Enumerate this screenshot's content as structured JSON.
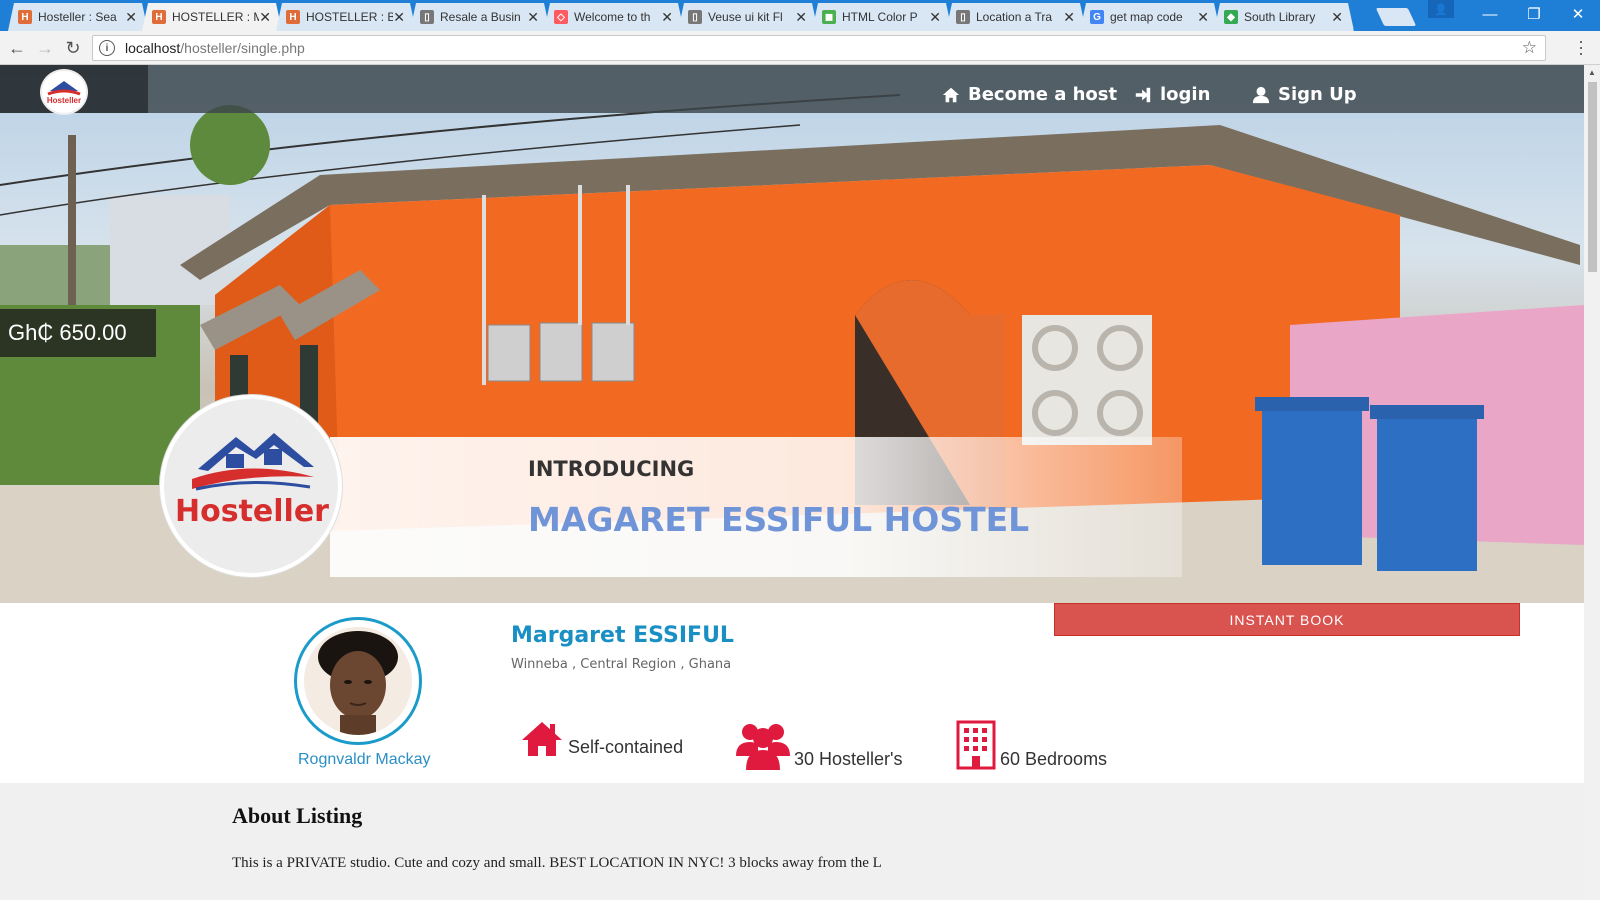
{
  "browser": {
    "tabs": [
      {
        "title": "Hosteller : Sea",
        "fav_color": "#e06c3a",
        "fav": "H"
      },
      {
        "title": "HOSTELLER : M",
        "fav_color": "#e06c3a",
        "fav": "H",
        "active": true
      },
      {
        "title": "HOSTELLER : B",
        "fav_color": "#e06c3a",
        "fav": "H"
      },
      {
        "title": "Resale a Busin",
        "fav_color": "#777777",
        "fav": "▯"
      },
      {
        "title": "Welcome to th",
        "fav_color": "#ff5a5f",
        "fav": "◇"
      },
      {
        "title": "Veuse ui kit Fl",
        "fav_color": "#777777",
        "fav": "▯"
      },
      {
        "title": "HTML Color P",
        "fav_color": "#4caf50",
        "fav": "◼"
      },
      {
        "title": "Location a Tra",
        "fav_color": "#777777",
        "fav": "▯"
      },
      {
        "title": "get map code",
        "fav_color": "#4285f4",
        "fav": "G"
      },
      {
        "title": "South Library",
        "fav_color": "#34a853",
        "fav": "◆"
      }
    ],
    "url_host": "localhost",
    "url_path": "/hosteller/single.php"
  },
  "nav": {
    "become_host": "Become a host",
    "login": "login",
    "signup": "Sign Up"
  },
  "hero": {
    "price": "Gh₵ 650.00",
    "intro_label": "INTRODUCING",
    "hostel_name": "MAGARET ESSIFUL HOSTEL",
    "logo_text": "Hosteller",
    "logo_small_text": "Hosteller"
  },
  "listing": {
    "instant_book": "INSTANT BOOK",
    "owner": "Margaret ESSIFUL",
    "location": "Winneba , Central Region , Ghana",
    "host_name": "Rognvaldr Mackay",
    "features": [
      {
        "icon": "house-icon",
        "label": "Self-contained"
      },
      {
        "icon": "users-icon",
        "label": "30 Hosteller's"
      },
      {
        "icon": "building-icon",
        "label": "60 Bedrooms"
      }
    ]
  },
  "about": {
    "title": "About Listing",
    "text": "This is a PRIVATE studio. Cute and cozy and small. BEST LOCATION IN NYC! 3 blocks away from the L"
  },
  "colors": {
    "accent_red": "#d9534f",
    "brand_blue": "#1a8fc4",
    "title_blue": "#6f95d8",
    "feature_red": "#e0193f"
  }
}
